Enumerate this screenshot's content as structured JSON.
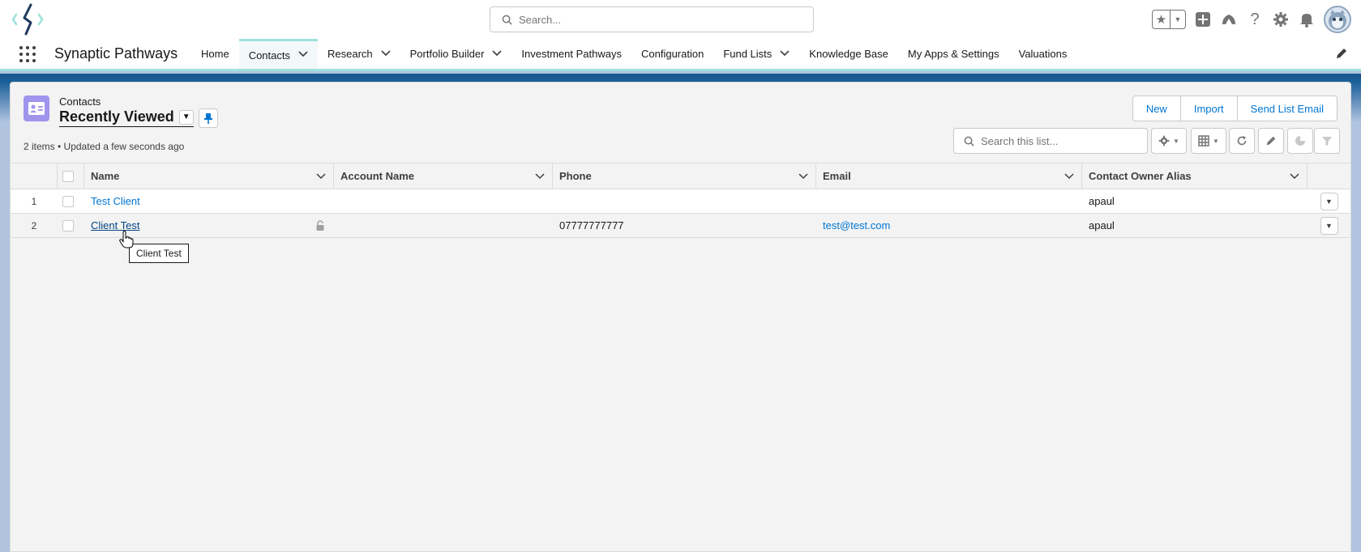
{
  "header": {
    "search_placeholder": "Search...",
    "icons": [
      "favorites-star-icon",
      "add-icon",
      "trailhead-icon",
      "help-icon",
      "setup-gear-icon",
      "notifications-bell-icon"
    ]
  },
  "nav": {
    "app_name": "Synaptic Pathways",
    "items": [
      {
        "label": "Home",
        "has_menu": false
      },
      {
        "label": "Contacts",
        "has_menu": true,
        "active": true
      },
      {
        "label": "Research",
        "has_menu": true
      },
      {
        "label": "Portfolio Builder",
        "has_menu": true
      },
      {
        "label": "Investment Pathways",
        "has_menu": false
      },
      {
        "label": "Configuration",
        "has_menu": false
      },
      {
        "label": "Fund Lists",
        "has_menu": true
      },
      {
        "label": "Knowledge Base",
        "has_menu": false
      },
      {
        "label": "My Apps & Settings",
        "has_menu": false
      },
      {
        "label": "Valuations",
        "has_menu": false
      }
    ]
  },
  "list_view": {
    "object_label": "Contacts",
    "title": "Recently Viewed",
    "meta": "2 items • Updated a few seconds ago",
    "buttons": {
      "new": "New",
      "import": "Import",
      "send_list_email": "Send List Email"
    },
    "search_placeholder": "Search this list..."
  },
  "table": {
    "columns": [
      "Name",
      "Account Name",
      "Phone",
      "Email",
      "Contact Owner Alias"
    ],
    "rows": [
      {
        "num": "1",
        "name": "Test Client",
        "account": "",
        "phone": "",
        "email": "",
        "owner": "apaul"
      },
      {
        "num": "2",
        "name": "Client Test",
        "account": "",
        "phone": "07777777777",
        "email": "test@test.com",
        "owner": "apaul"
      }
    ]
  },
  "tooltip": "Client Test",
  "colors": {
    "accent": "#0176d3",
    "nav_active": "#9ee1dc",
    "object_icon": "#a094ed",
    "banner": "#17568c"
  }
}
